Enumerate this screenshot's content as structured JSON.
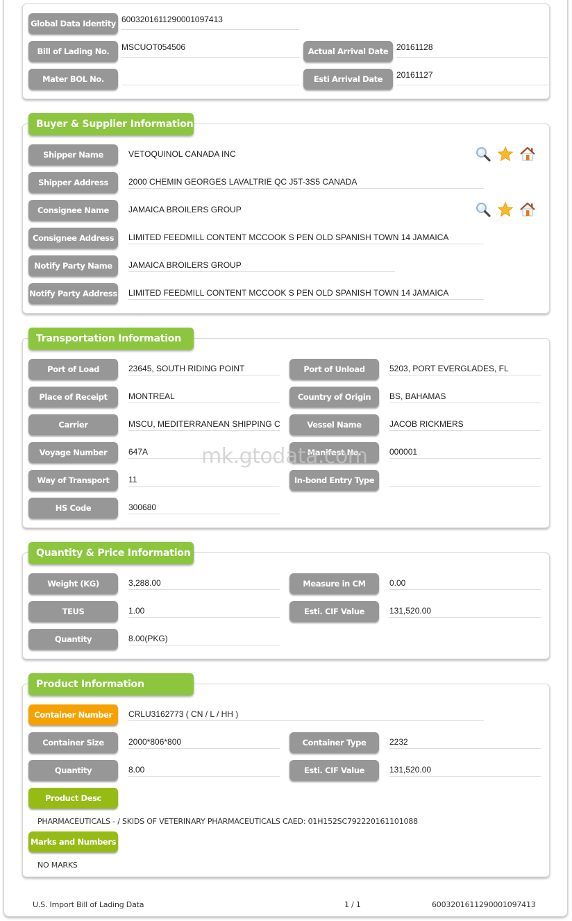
{
  "header": {
    "global_data_identity": {
      "label": "Global Data Identity",
      "value": "600320161129000109741 3"
    },
    "bill_of_lading": {
      "label": "Bill of Lading No.",
      "value": "MSCUOT054506"
    },
    "actual_arrival": {
      "label": "Actual Arrival Date",
      "value": "20161128"
    },
    "mater_bol": {
      "label": "Mater BOL No.",
      "value": ""
    },
    "esti_arrival": {
      "label": "Esti Arrival Date",
      "value": "20161127"
    }
  },
  "buyer_supplier": {
    "title": "Buyer & Supplier Information",
    "shipper_name": {
      "label": "Shipper Name",
      "value": "VETOQUINOL CANADA INC"
    },
    "shipper_address": {
      "label": "Shipper Address",
      "value": "2000 CHEMIN GEORGES LAVALTRIE QC J5T-3S5 CANADA"
    },
    "consignee_name": {
      "label": "Consignee Name",
      "value": "JAMAICA BROILERS GROUP"
    },
    "consignee_address": {
      "label": "Consignee Address",
      "value": "LIMITED FEEDMILL CONTENT MCCOOK S PEN OLD SPANISH TOWN 14 JAMAICA"
    },
    "notify_party_name": {
      "label": "Notify Party Name",
      "value": "JAMAICA BROILERS GROUP"
    },
    "notify_party_address": {
      "label": "Notify Party Address",
      "value": "LIMITED FEEDMILL CONTENT MCCOOK S PEN OLD SPANISH TOWN 14 JAMAICA"
    },
    "row_icons": [
      "search-icon",
      "star-icon",
      "home-icon"
    ]
  },
  "transportation": {
    "title": "Transportation Information",
    "port_of_load": {
      "label": "Port of Load",
      "value": "23645, SOUTH RIDING POINT"
    },
    "port_of_unload": {
      "label": "Port of Unload",
      "value": "5203, PORT EVERGLADES, FL"
    },
    "place_of_receipt": {
      "label": "Place of Receipt",
      "value": "MONTREAL"
    },
    "country_of_origin": {
      "label": "Country of Origin",
      "value": "BS, BAHAMAS"
    },
    "carrier": {
      "label": "Carrier",
      "value": "MSCU, MEDITERRANEAN SHIPPING CO"
    },
    "vessel_name": {
      "label": "Vessel Name",
      "value": "JACOB RICKMERS"
    },
    "voyage_number": {
      "label": "Voyage Number",
      "value": "647A"
    },
    "manifest_no": {
      "label": "Manifest No.",
      "value": "000001"
    },
    "way_of_transport": {
      "label": "Way of Transport",
      "value": "11"
    },
    "inbond_entry_type": {
      "label": "In-bond Entry Type",
      "value": ""
    },
    "hs_code": {
      "label": "HS Code",
      "value": "300680"
    }
  },
  "quantity_price": {
    "title": "Quantity & Price Information",
    "weight": {
      "label": "Weight (KG)",
      "value": "3,288.00"
    },
    "measure": {
      "label": "Measure in CM",
      "value": "0.00"
    },
    "teus": {
      "label": "TEUS",
      "value": "1.00"
    },
    "cif_value": {
      "label": "Esti. CIF Value",
      "value": "131,520.00"
    },
    "quantity": {
      "label": "Quantity",
      "value": "8.00(PKG)"
    }
  },
  "product": {
    "title": "Product Information",
    "container_number": {
      "label": "Container Number",
      "value": "CRLU3162773 ( CN / L / HH )"
    },
    "container_size": {
      "label": "Container Size",
      "value": "2000*806*800"
    },
    "container_type": {
      "label": "Container Type",
      "value": "2232"
    },
    "quantity": {
      "label": "Quantity",
      "value": "8.00"
    },
    "cif_value": {
      "label": "Esti. CIF Value",
      "value": "131,520.00"
    },
    "product_desc": {
      "label": "Product Desc",
      "value": "PHARMACEUTICALS - / SKIDS OF VETERINARY PHARMACEUTICALS CAED: 01H152SC792220161101088"
    },
    "marks_numbers": {
      "label": "Marks and Numbers",
      "value": "NO MARKS"
    }
  },
  "watermark": "mk.gtodata.com",
  "footer": {
    "title": "U.S. Import Bill of Lading Data",
    "page": "1 / 1",
    "id": "6003201611290001097413"
  },
  "colors": {
    "section_header": "#8cc63e",
    "label_gray": "#979797",
    "label_orange": "#f7a100",
    "label_green": "#96bb14"
  }
}
